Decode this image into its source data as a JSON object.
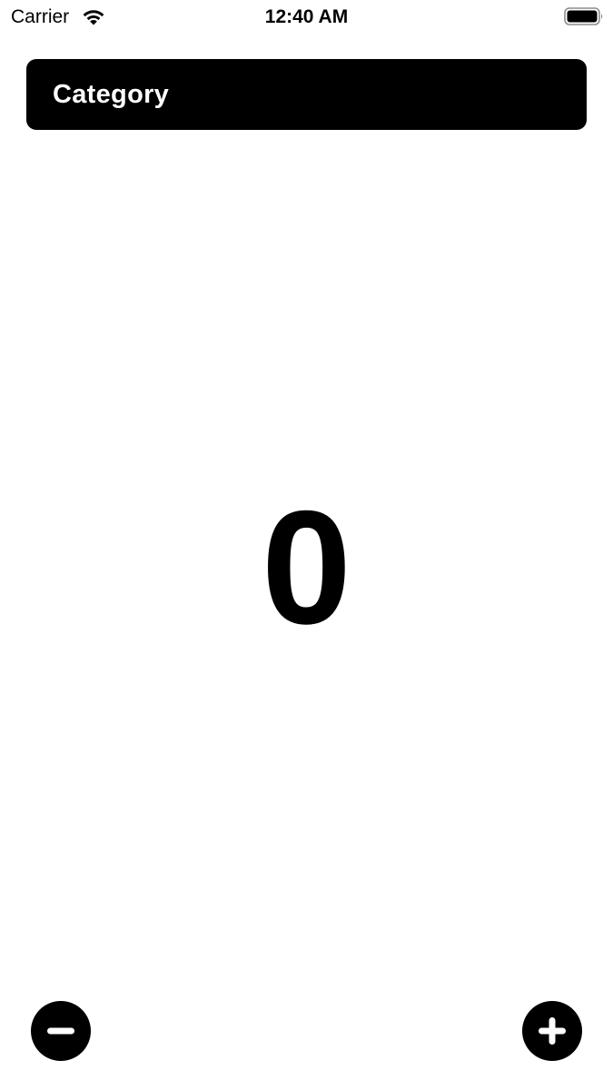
{
  "status_bar": {
    "carrier": "Carrier",
    "time": "12:40 AM",
    "wifi_icon": "wifi-icon",
    "battery_icon": "battery-full-icon"
  },
  "header": {
    "category_label": "Category"
  },
  "counter": {
    "value": "0"
  },
  "controls": {
    "decrement_icon": "minus-circle-icon",
    "increment_icon": "plus-circle-icon"
  },
  "colors": {
    "background": "#ffffff",
    "foreground": "#000000",
    "header_text": "#ffffff"
  }
}
